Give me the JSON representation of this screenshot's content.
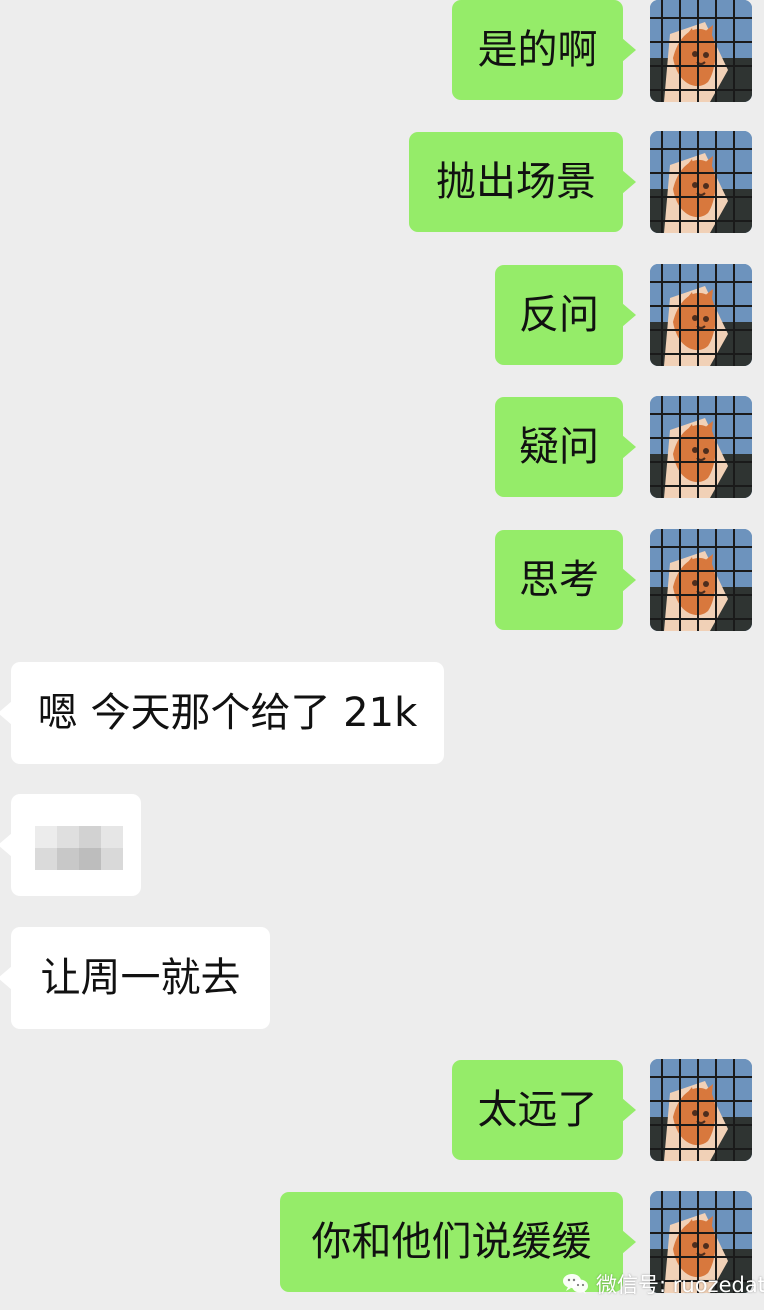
{
  "chat": {
    "messages": [
      {
        "side": "out",
        "text": "是的啊"
      },
      {
        "side": "out",
        "text": "抛出场景"
      },
      {
        "side": "out",
        "text": "反问"
      },
      {
        "side": "out",
        "text": "疑问"
      },
      {
        "side": "out",
        "text": "思考"
      },
      {
        "side": "in",
        "text": "嗯 今天那个给了 21k"
      },
      {
        "side": "in",
        "text": ""
      },
      {
        "side": "in",
        "text": "让周一就去"
      },
      {
        "side": "out",
        "text": "太远了"
      },
      {
        "side": "out",
        "text": "你和他们说缓缓"
      }
    ]
  },
  "watermark": {
    "text": "微信号: ruozedata"
  },
  "icons": {
    "avatar": "cat-photo-avatar",
    "watermark": "wechat-icon"
  },
  "colors": {
    "background": "#ededed",
    "outgoing_bubble": "#95ec69",
    "incoming_bubble": "#ffffff"
  }
}
